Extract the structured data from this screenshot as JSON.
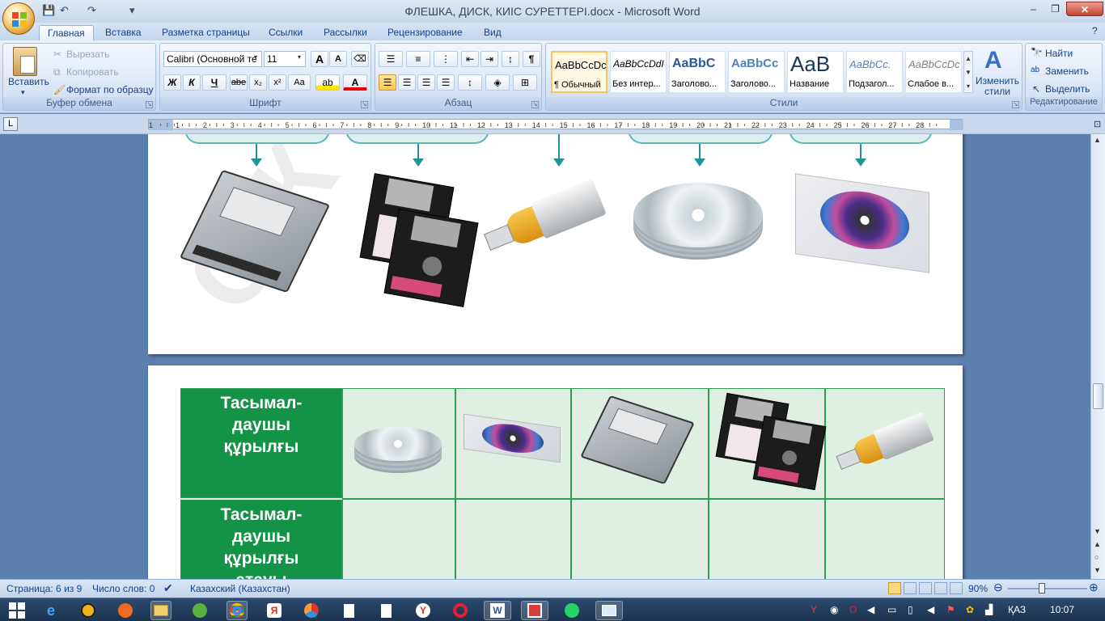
{
  "window": {
    "title": "ФЛЕШКА, ДИСК, КИІС СУРЕТТЕРІ.docx - Microsoft Word",
    "buttons": {
      "minimize": "–",
      "maximize": "❐",
      "close": "✕"
    }
  },
  "qat": {
    "save": "💾",
    "undo": "↶",
    "redo": "↷",
    "dropdown": "▾"
  },
  "tabs": [
    "Главная",
    "Вставка",
    "Разметка страницы",
    "Ссылки",
    "Рассылки",
    "Рецензирование",
    "Вид"
  ],
  "clipboard": {
    "paste": "Вставить",
    "cut": "Вырезать",
    "copy": "Копировать",
    "format_painter": "Формат по образцу",
    "label": "Буфер обмена"
  },
  "font": {
    "name": "Calibri (Основной те",
    "size": "11",
    "label": "Шрифт",
    "bold": "Ж",
    "italic": "К",
    "underline": "Ч",
    "strike": "abe",
    "subscript": "x₂",
    "superscript": "x²",
    "case": "Aa",
    "grow": "A",
    "shrink": "A"
  },
  "paragraph": {
    "label": "Абзац",
    "pilcrow": "¶"
  },
  "styles": {
    "label": "Стили",
    "items": [
      {
        "preview": "AaBbCcDc",
        "name": "¶ Обычный"
      },
      {
        "preview": "AaBbCcDdI",
        "name": "Без интер..."
      },
      {
        "preview": "AaBbC",
        "name": "Заголово..."
      },
      {
        "preview": "AaBbCc",
        "name": "Заголово..."
      },
      {
        "preview": "AaB",
        "name": "Название"
      },
      {
        "preview": "AaBbCc.",
        "name": "Подзагол..."
      },
      {
        "preview": "AaBbCcDc",
        "name": "Слабое в..."
      }
    ],
    "change": "Изменить стили"
  },
  "editing": {
    "label": "Редактирование",
    "find": "Найти",
    "replace": "Заменить",
    "select": "Выделить"
  },
  "ruler": {
    "numbers": [
      "1",
      "1",
      "2",
      "3",
      "4",
      "5",
      "6",
      "7",
      "8",
      "9",
      "10",
      "11",
      "12",
      "13",
      "14",
      "15",
      "16",
      "17",
      "18",
      "19",
      "20",
      "21",
      "22",
      "23",
      "24",
      "25",
      "26",
      "27",
      "28"
    ]
  },
  "document": {
    "table_header_1": [
      "Тасымал-",
      "даушы",
      "құрылғы"
    ],
    "table_header_2": [
      "Тасымал-",
      "даушы",
      "құрылғы",
      "атауы"
    ]
  },
  "status": {
    "page": "Страница: 6 из 9",
    "words": "Число слов: 0",
    "language": "Казахский (Казахстан)",
    "zoom": "90%"
  },
  "taskbar": {
    "lang": "ҚАЗ",
    "time": "10:07"
  },
  "colors": {
    "ribbon_bg": "#dbe6f4",
    "doc_bg": "#5d7fae",
    "table_green": "#139346",
    "accent_teal": "#1e9496"
  }
}
